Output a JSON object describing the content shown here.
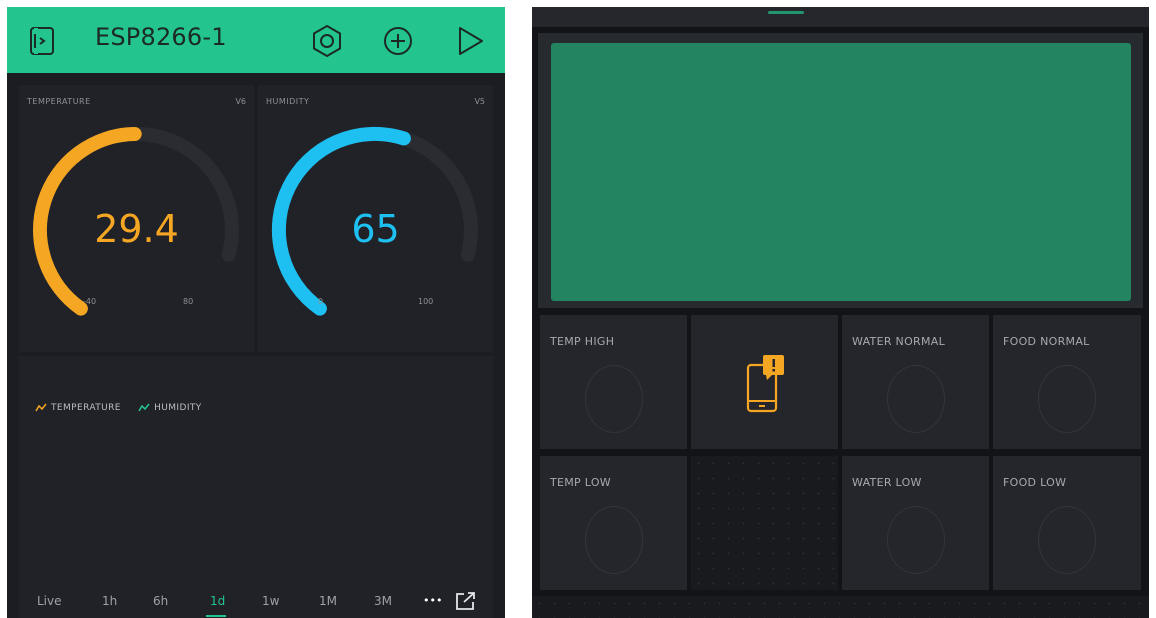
{
  "device": {
    "name": "ESP8266-1",
    "accent": "#23c48e"
  },
  "gauges": [
    {
      "label": "TEMPERATURE",
      "pin": "V6",
      "value": "29.4",
      "min": "-40",
      "max": "80",
      "fraction": 0.577,
      "color": "#f5a623"
    },
    {
      "label": "HUMIDITY",
      "pin": "V5",
      "value": "65",
      "min": "0",
      "max": "100",
      "fraction": 0.65,
      "color": "#1ec0f2"
    }
  ],
  "chart": {
    "legend": [
      {
        "name": "TEMPERATURE",
        "color": "#f5a623"
      },
      {
        "name": "HUMIDITY",
        "color": "#23c48e"
      }
    ],
    "tabs": [
      "Live",
      "1h",
      "6h",
      "1d",
      "1w",
      "1M",
      "3M"
    ],
    "active_tab": "1d",
    "more": "•••"
  },
  "indicators": [
    {
      "label": "TEMP HIGH"
    },
    {
      "label": "WATER NORMAL"
    },
    {
      "label": "FOOD NORMAL"
    },
    {
      "label": "TEMP LOW"
    },
    {
      "label": "WATER LOW"
    },
    {
      "label": "FOOD LOW"
    }
  ],
  "icons": {
    "device": "device-icon",
    "settings": "settings-icon",
    "add": "add-icon",
    "play": "play-icon",
    "notification": "notification-icon",
    "expand": "expand-icon"
  },
  "lcd_color": "#238462"
}
